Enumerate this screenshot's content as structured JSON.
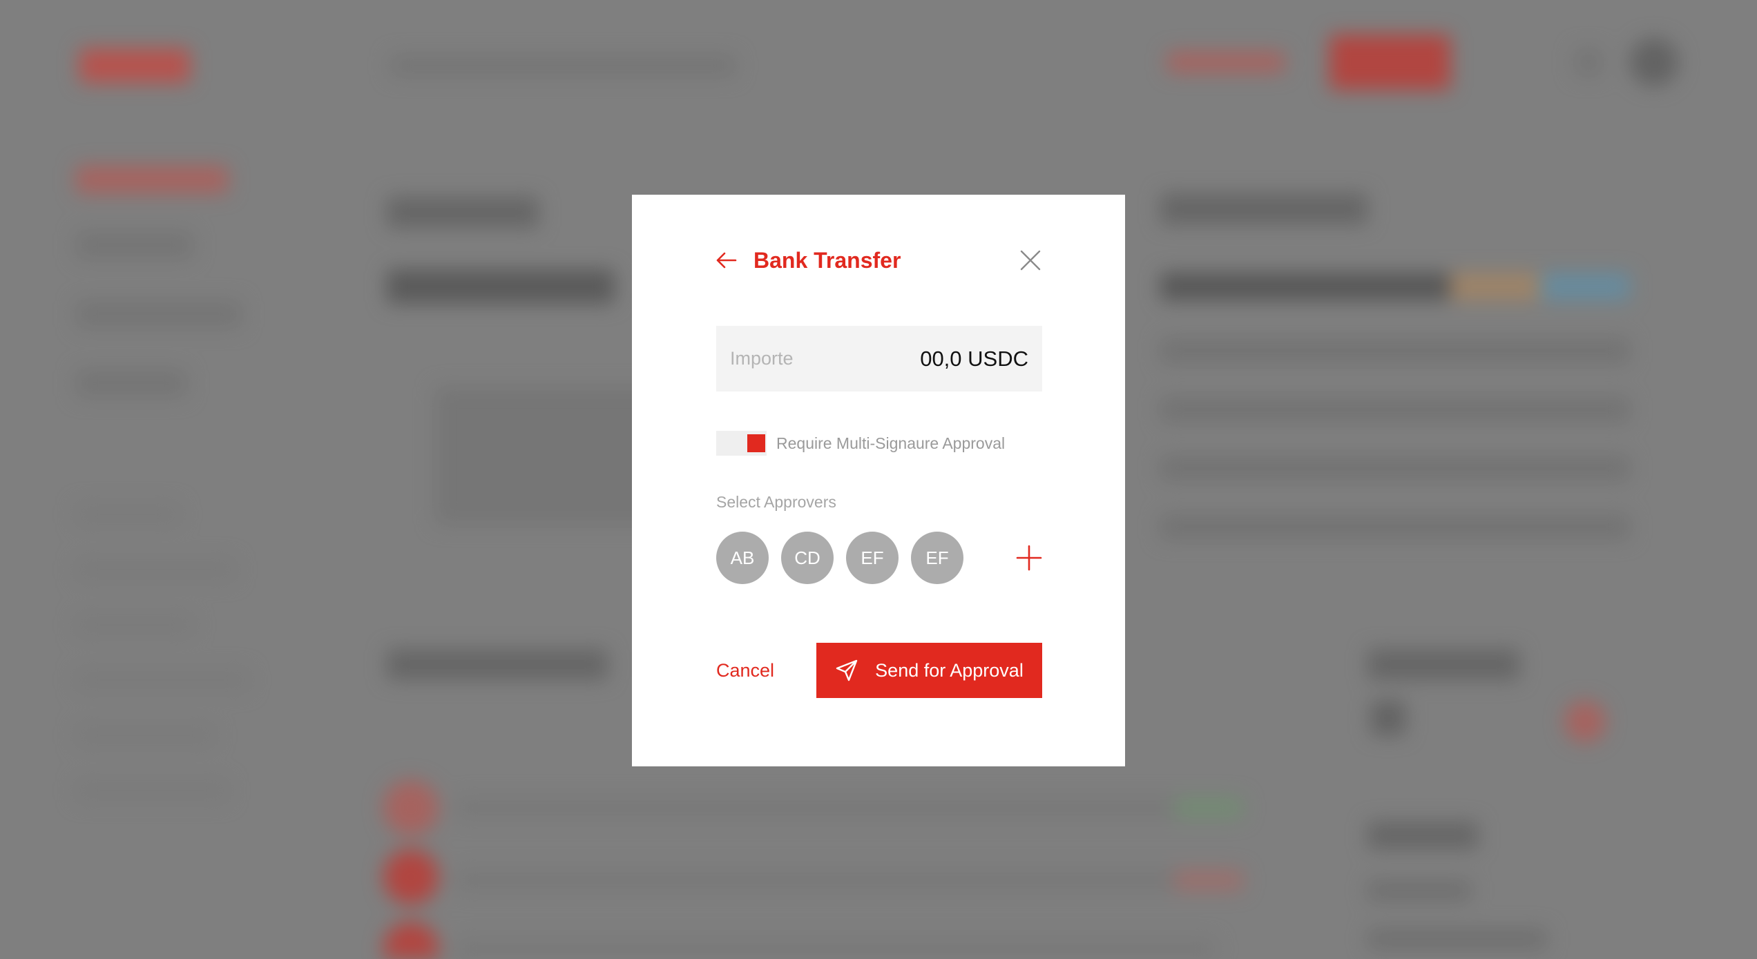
{
  "dialog": {
    "title": "Bank Transfer",
    "amount_label": "Importe",
    "amount_value": "00,0 USDC",
    "toggle_label": "Require Multi-Signaure Approval",
    "approvers_label": "Select Approvers",
    "approvers": [
      "AB",
      "CD",
      "EF",
      "EF"
    ],
    "cancel_label": "Cancel",
    "send_label": "Send for Approval"
  },
  "colors": {
    "accent": "#e1291f",
    "avatar": "#acacac",
    "backdrop": "#7f7f7f"
  },
  "icons": {
    "back": "arrow-left-icon",
    "close": "close-icon",
    "add": "plus-icon",
    "send": "paper-plane-icon"
  }
}
